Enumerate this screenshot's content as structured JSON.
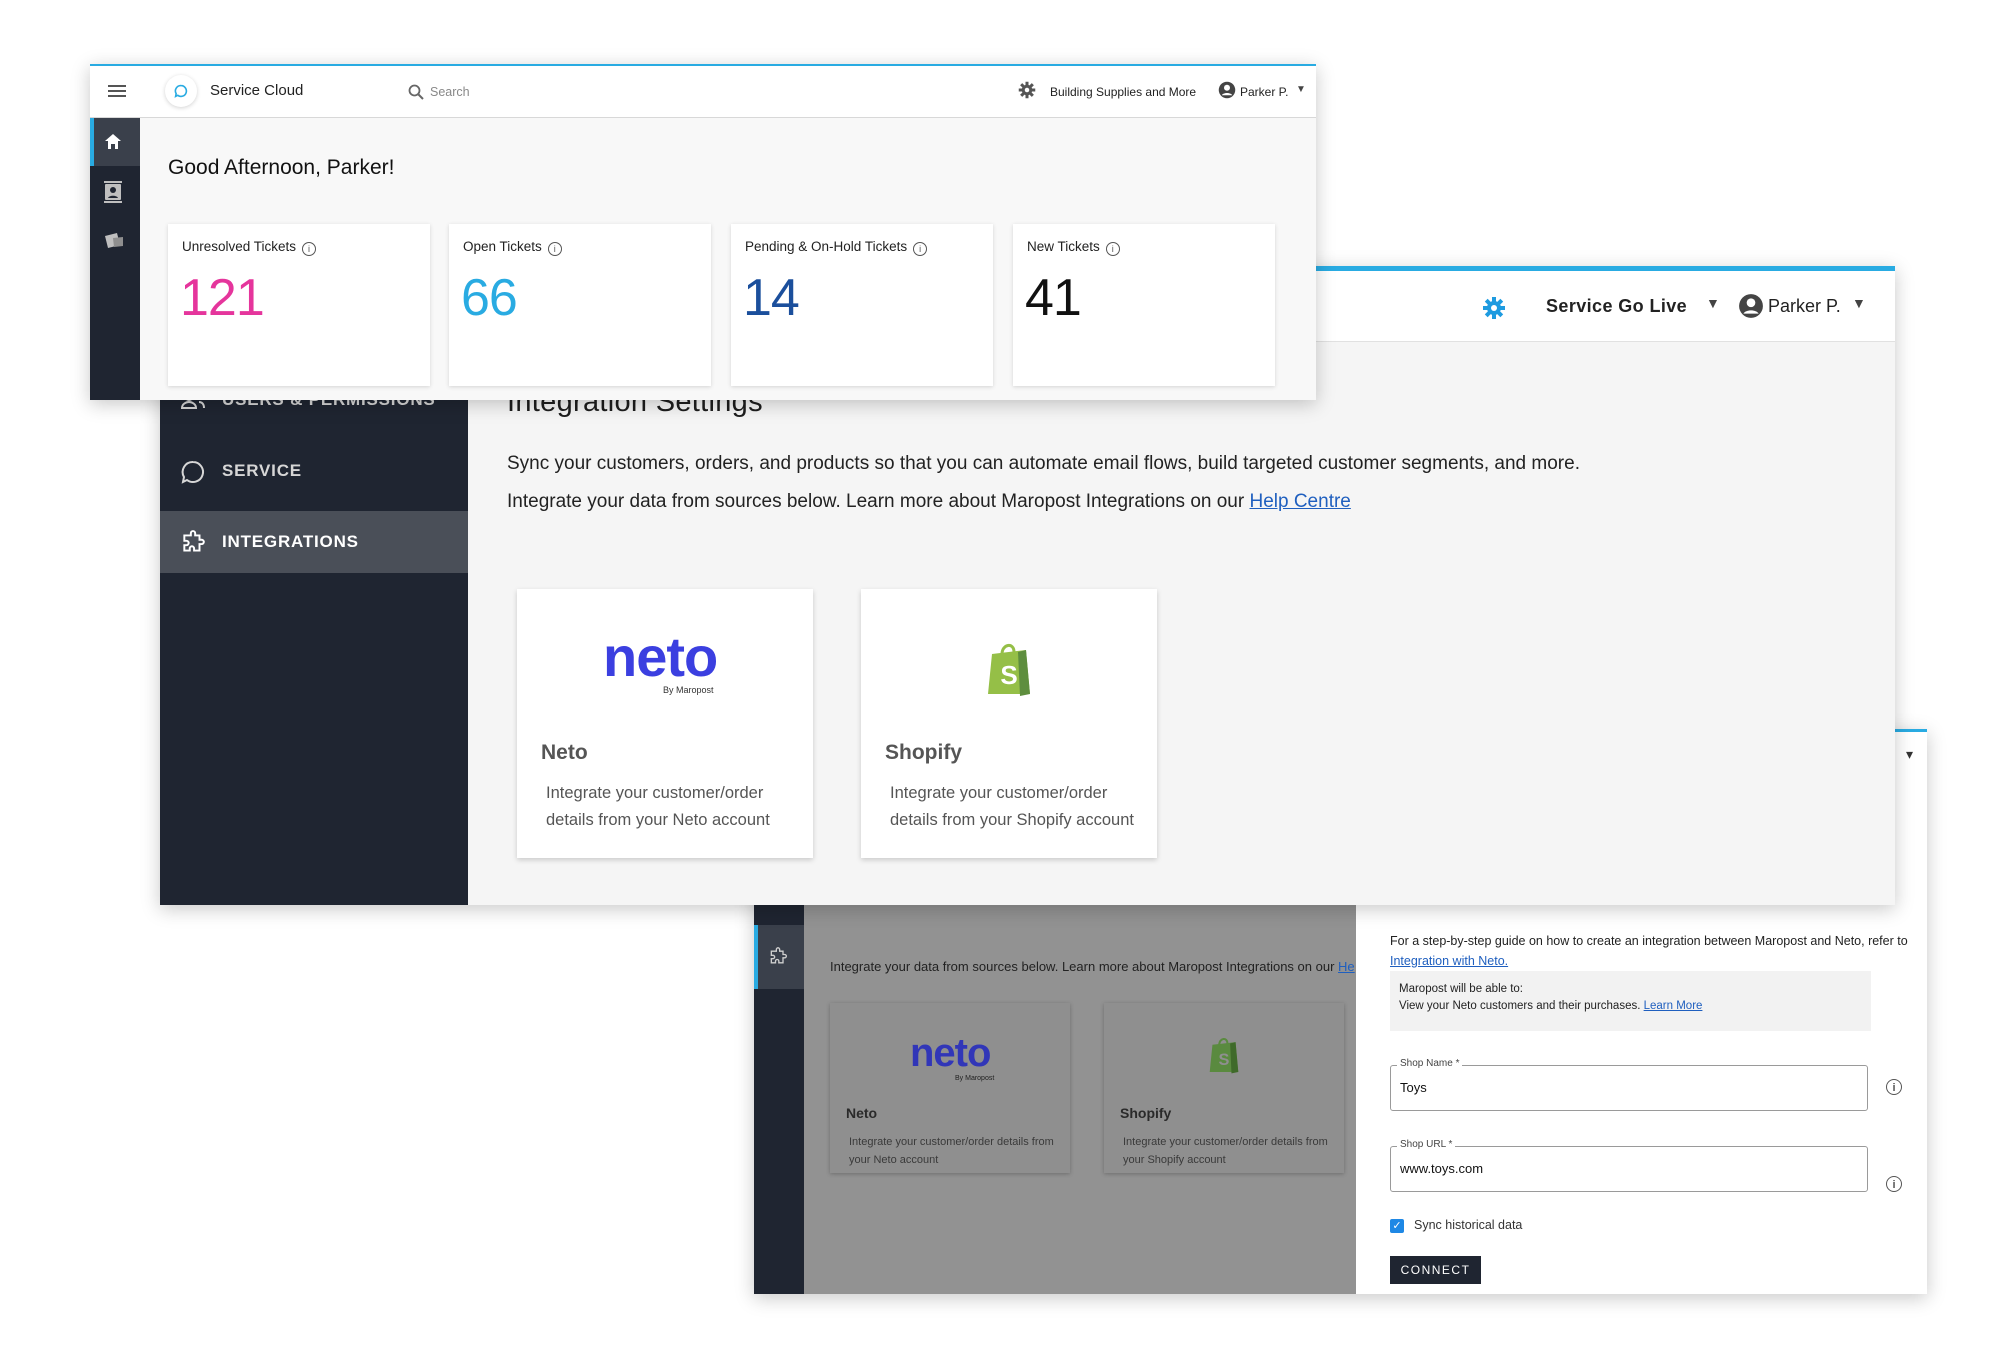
{
  "neto_dialog": {
    "sidebar_line": "Integrate your data from sources below. Learn more about Maropost Integrations on our",
    "sidebar_line_link": "He",
    "cards": [
      {
        "logo": "neto",
        "logo_sub": "By Maropost",
        "title": "Neto",
        "description": "Integrate your customer/order details from your Neto account"
      },
      {
        "logo": "shopify-bag-icon",
        "title": "Shopify",
        "description": "Integrate your customer/order details from your Shopify account"
      }
    ],
    "guide_text": "For a step-by-step guide on how to create an integration between Maropost and Neto, refer to",
    "guide_link": "Integration with Neto.",
    "info_title": "Maropost will be able to:",
    "info_text": "View your Neto customers and their purchases.",
    "info_link": "Learn More",
    "shop_name_label": "Shop Name *",
    "shop_name_value": "Toys",
    "shop_url_label": "Shop URL *",
    "shop_url_value": "www.toys.com",
    "sync_label": "Sync historical data",
    "sync_checked": true,
    "connect_label": "CONNECT"
  },
  "integration_settings": {
    "org_name": "Service Go Live",
    "user_name": "Parker P.",
    "nav": [
      {
        "label": "USERS & PERMISSIONS",
        "icon": "users-icon"
      },
      {
        "label": "SERVICE",
        "icon": "chat-bubble-icon"
      },
      {
        "label": "INTEGRATIONS",
        "icon": "puzzle-icon",
        "active": true
      }
    ],
    "title": "Integration Settings",
    "paragraph1": "Sync your customers, orders, and products so that you can automate email flows, build targeted customer segments, and more.",
    "paragraph2": "Integrate your data from sources below. Learn more about Maropost Integrations on our",
    "help_link": "Help Centre",
    "cards": [
      {
        "logo": "neto",
        "logo_sub": "By Maropost",
        "title": "Neto",
        "description": "Integrate your customer/order details from your Neto account"
      },
      {
        "logo": "shopify-bag-icon",
        "title": "Shopify",
        "description": "Integrate your customer/order details from your Shopify account"
      }
    ]
  },
  "dashboard": {
    "app_name": "Service Cloud",
    "search_placeholder": "Search",
    "org_name": "Building Supplies and More",
    "user_name": "Parker P.",
    "greeting": "Good Afternoon, Parker!",
    "stats": [
      {
        "label": "Unresolved Tickets",
        "value": "121",
        "color": "#e5359c"
      },
      {
        "label": "Open Tickets",
        "value": "66",
        "color": "#29abe2"
      },
      {
        "label": "Pending & On-Hold Tickets",
        "value": "14",
        "color": "#1b4f9c"
      },
      {
        "label": "New Tickets",
        "value": "41",
        "color": "#111111"
      }
    ]
  },
  "colors": {
    "accent": "#29abe2",
    "sidebar": "#1f2531",
    "link": "#1f5fbf",
    "neto": "#3b3fe0",
    "shopify": "#7ab55c"
  }
}
